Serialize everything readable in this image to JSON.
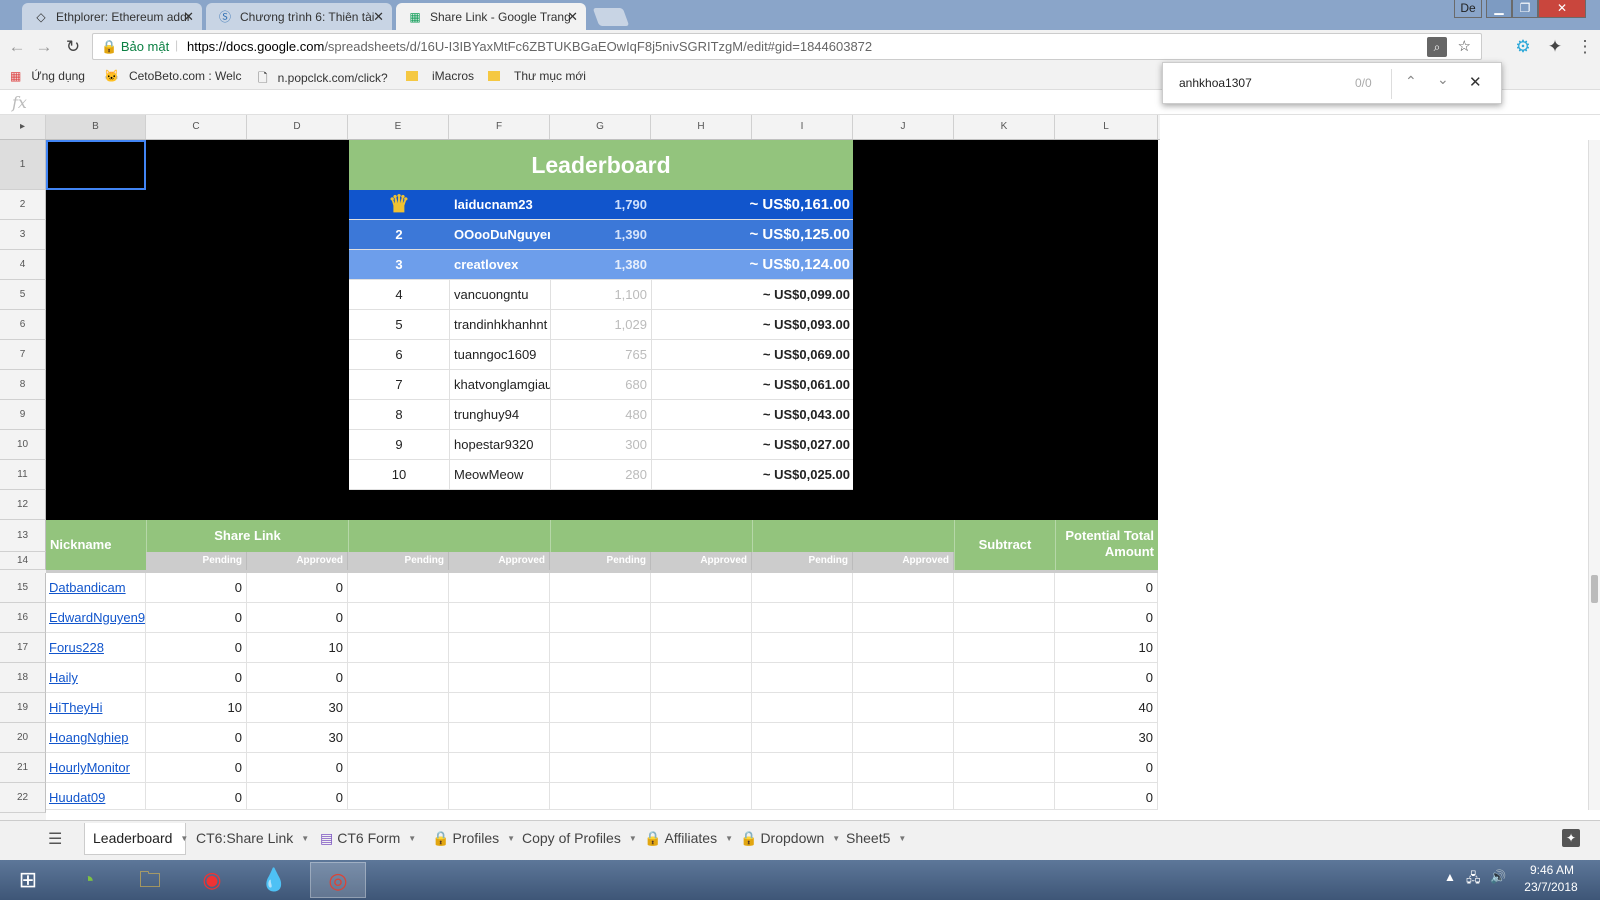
{
  "browser": {
    "tabs": [
      {
        "label": "Ethplorer: Ethereum addr",
        "icon": "diamond-icon"
      },
      {
        "label": "Chương trình 6: Thiên tài",
        "icon": "s-logo-icon"
      },
      {
        "label": "Share Link - Google Trang",
        "icon": "sheets-icon",
        "active": true
      }
    ],
    "window_user": "De",
    "secure_label": "Bảo mật",
    "url_host": "https://docs.google.com",
    "url_rest": "/spreadsheets/d/16U-I3IBYaxMtFc6ZBTUKBGaEOwIqF8j5nivSGRITzgM/edit#gid=1844603872",
    "bookmarks": [
      "Ứng dụng",
      "CetoBeto.com : Welc",
      "n.popclck.com/click?",
      "iMacros",
      "Thư mục mới"
    ]
  },
  "find": {
    "query": "anhkhoa1307",
    "count": "0/0"
  },
  "formula_bar": {
    "fx": "fx"
  },
  "columns": [
    "B",
    "C",
    "D",
    "E",
    "F",
    "G",
    "H",
    "I",
    "J",
    "K",
    "L"
  ],
  "rows": [
    "1",
    "2",
    "3",
    "4",
    "5",
    "6",
    "7",
    "8",
    "9",
    "10",
    "11",
    "12",
    "13",
    "14",
    "15",
    "16",
    "17",
    "18",
    "19",
    "20",
    "21",
    "22"
  ],
  "leaderboard": {
    "title": "Leaderboard",
    "entries": [
      {
        "rank": "",
        "name": "laiducnam23",
        "points": "1,790",
        "amount": "~ US$0,161.00"
      },
      {
        "rank": "2",
        "name": "OOooDuNguyen",
        "points": "1,390",
        "amount": "~ US$0,125.00"
      },
      {
        "rank": "3",
        "name": "creatlovex",
        "points": "1,380",
        "amount": "~ US$0,124.00"
      },
      {
        "rank": "4",
        "name": "vancuongntu",
        "points": "1,100",
        "amount": "~ US$0,099.00"
      },
      {
        "rank": "5",
        "name": "trandinhkhanhnt",
        "points": "1,029",
        "amount": "~ US$0,093.00"
      },
      {
        "rank": "6",
        "name": "tuanngoc1609",
        "points": "765",
        "amount": "~ US$0,069.00"
      },
      {
        "rank": "7",
        "name": "khatvonglamgiau",
        "points": "680",
        "amount": "~ US$0,061.00"
      },
      {
        "rank": "8",
        "name": "trunghuy94",
        "points": "480",
        "amount": "~ US$0,043.00"
      },
      {
        "rank": "9",
        "name": "hopestar9320",
        "points": "300",
        "amount": "~ US$0,027.00"
      },
      {
        "rank": "10",
        "name": "MeowMeow",
        "points": "280",
        "amount": "~ US$0,025.00"
      }
    ]
  },
  "table": {
    "nickname_header": "Nickname",
    "share_link_header": "Share Link",
    "subtract_header": "Subtract",
    "potential_header": "Potential Total Amount",
    "pending": "Pending",
    "approved": "Approved",
    "rows": [
      {
        "nick": "Datbandicam",
        "pending": "0",
        "approved": "0",
        "total": "0"
      },
      {
        "nick": "EdwardNguyen9",
        "pending": "0",
        "approved": "0",
        "total": "0"
      },
      {
        "nick": "Forus228",
        "pending": "0",
        "approved": "10",
        "total": "10"
      },
      {
        "nick": "Haily",
        "pending": "0",
        "approved": "0",
        "total": "0"
      },
      {
        "nick": "HiTheyHi",
        "pending": "10",
        "approved": "30",
        "total": "40"
      },
      {
        "nick": "HoangNghiep",
        "pending": "0",
        "approved": "30",
        "total": "30"
      },
      {
        "nick": "HourlyMonitor",
        "pending": "0",
        "approved": "0",
        "total": "0"
      },
      {
        "nick": "Huudat09",
        "pending": "0",
        "approved": "0",
        "total": "0"
      }
    ]
  },
  "sheet_tabs": [
    {
      "label": "Leaderboard",
      "active": true,
      "icon": ""
    },
    {
      "label": "CT6:Share Link",
      "icon": ""
    },
    {
      "label": "CT6 Form",
      "icon": "form-icon"
    },
    {
      "label": "Profiles",
      "icon": "lock-icon"
    },
    {
      "label": "Copy of Profiles",
      "icon": ""
    },
    {
      "label": "Affiliates",
      "icon": "lock-icon"
    },
    {
      "label": "Dropdown",
      "icon": "lock-icon"
    },
    {
      "label": "Sheet5",
      "icon": ""
    }
  ],
  "taskbar": {
    "time": "9:46 AM",
    "date": "23/7/2018"
  },
  "colors": {
    "green": "#93c47d",
    "rank1": "#1155cc",
    "rank2": "#3c78d8",
    "rank3": "#6d9eeb"
  }
}
